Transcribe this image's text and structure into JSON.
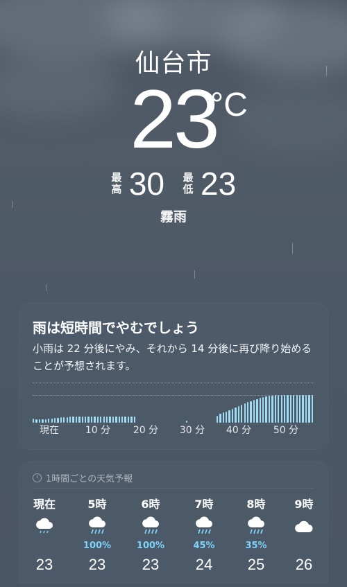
{
  "location": {
    "city": "仙台市",
    "temperature": "23",
    "unit": "°C",
    "high_label": "最高",
    "high": "30",
    "low_label": "最低",
    "low": "23",
    "condition": "霧雨"
  },
  "precip_card": {
    "title": "雨は短時間でやむでしょう",
    "description": "小雨は 22 分後にやみ、それから 14 分後に再び降り始めることが予想されます。",
    "axis_labels": [
      "現在",
      "10 分",
      "20 分",
      "30 分",
      "40 分",
      "50 分"
    ],
    "intensity": [
      0.12,
      0.1,
      0.1,
      0.1,
      0.11,
      0.12,
      0.13,
      0.14,
      0.15,
      0.16,
      0.17,
      0.17,
      0.18,
      0.18,
      0.18,
      0.18,
      0.18,
      0.18,
      0.18,
      0.18,
      0.18,
      0.18,
      0.18,
      0.18,
      0.18,
      0.18,
      0.18,
      0.18,
      0.18,
      0.18,
      0.18,
      0.18,
      0.18,
      0.18,
      0,
      0,
      0,
      0,
      0,
      0,
      0,
      0,
      0,
      0,
      0,
      0,
      0,
      0,
      0,
      0,
      0.06,
      0,
      0,
      0,
      0,
      0,
      0,
      0,
      0,
      0,
      0.2,
      0.26,
      0.3,
      0.33,
      0.36,
      0.4,
      0.44,
      0.48,
      0.52,
      0.56,
      0.6,
      0.63,
      0.66,
      0.69,
      0.72,
      0.74,
      0.76,
      0.78,
      0.79,
      0.8,
      0.8,
      0.8,
      0.8,
      0.8,
      0.8,
      0.8,
      0.8,
      0.8,
      0.8,
      0.8,
      0.8,
      0.8
    ]
  },
  "hourly": {
    "header": "1時間ごとの天気予報",
    "items": [
      {
        "hour": "現在",
        "icon": "rain-cloud-icon",
        "pct": "",
        "temp": "23"
      },
      {
        "hour": "5時",
        "icon": "heavy-rain-cloud-icon",
        "pct": "100%",
        "temp": "23"
      },
      {
        "hour": "6時",
        "icon": "heavy-rain-cloud-icon",
        "pct": "100%",
        "temp": "23"
      },
      {
        "hour": "7時",
        "icon": "heavy-rain-cloud-icon",
        "pct": "45%",
        "temp": "24"
      },
      {
        "hour": "8時",
        "icon": "heavy-rain-cloud-icon",
        "pct": "35%",
        "temp": "25"
      },
      {
        "hour": "9時",
        "icon": "cloud-icon",
        "pct": "",
        "temp": "26"
      }
    ]
  },
  "colors": {
    "precip_bar": "#9fdcf5",
    "precip_pct": "#7dd3f7"
  }
}
